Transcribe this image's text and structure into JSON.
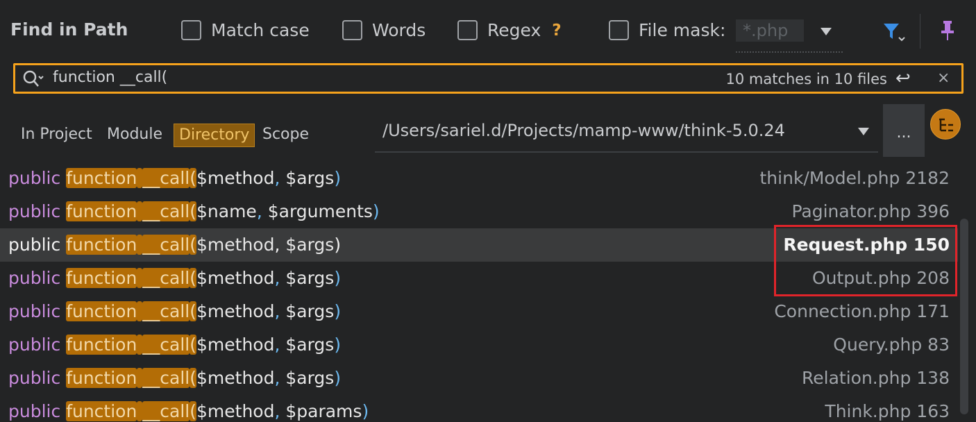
{
  "dialog": {
    "title": "Find in Path",
    "options": {
      "match_case": {
        "label": "Match case",
        "checked": false
      },
      "words": {
        "label": "Words",
        "checked": false
      },
      "regex": {
        "label": "Regex",
        "checked": false,
        "help": "?"
      },
      "file_mask": {
        "label": "File mask:",
        "checked": false,
        "value": "*.php"
      }
    },
    "icons": {
      "filter": "filter-icon",
      "pin": "pin-icon"
    }
  },
  "search": {
    "query": "function __call(",
    "match_count": "10 matches in 10 files",
    "enter_glyph": "↩",
    "clear_glyph": "×"
  },
  "scope": {
    "tabs": [
      "In Project",
      "Module",
      "Directory",
      "Scope"
    ],
    "active": "Directory",
    "path": "/Users/sariel.d/Projects/mamp-www/think-5.0.24",
    "browse_label": "..."
  },
  "results": [
    {
      "kw": "public",
      "fn": "function",
      "name": "__call",
      "args": [
        "$method",
        "$args"
      ],
      "file": "think/Model.php 2182",
      "selected": false
    },
    {
      "kw": "public",
      "fn": "function",
      "name": "__call",
      "args": [
        "$name",
        "$arguments"
      ],
      "file": "Paginator.php 396",
      "selected": false
    },
    {
      "kw": "public",
      "fn": "function",
      "name": "__call",
      "args": [
        "$method",
        "$args"
      ],
      "file": "Request.php 150",
      "selected": true
    },
    {
      "kw": "public",
      "fn": "function",
      "name": "__call",
      "args": [
        "$method",
        "$args"
      ],
      "file": "Output.php 208",
      "selected": false
    },
    {
      "kw": "public",
      "fn": "function",
      "name": "__call",
      "args": [
        "$method",
        "$args"
      ],
      "file": "Connection.php 171",
      "selected": false
    },
    {
      "kw": "public",
      "fn": "function",
      "name": "__call",
      "args": [
        "$method",
        "$args"
      ],
      "file": "Query.php 83",
      "selected": false
    },
    {
      "kw": "public",
      "fn": "function",
      "name": "__call",
      "args": [
        "$method",
        "$args"
      ],
      "file": "Relation.php 138",
      "selected": false
    },
    {
      "kw": "public",
      "fn": "function",
      "name": "__call",
      "args": [
        "$method",
        "$params"
      ],
      "file": "Think.php 163",
      "selected": false
    }
  ],
  "colors": {
    "accent": "#f5a21c",
    "highlight": "#b36d06",
    "annotation": "#e0242a"
  }
}
